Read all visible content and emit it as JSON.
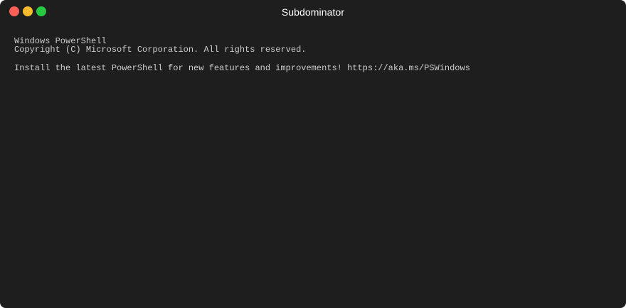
{
  "window": {
    "title": "Subdominator",
    "controls": {
      "close_color": "#ff5f57",
      "minimize_color": "#febc2e",
      "zoom_color": "#28c840"
    },
    "background": "#1e1e1e"
  },
  "terminal": {
    "lines": [
      "Windows PowerShell",
      "Copyright (C) Microsoft Corporation. All rights reserved.",
      "",
      "Install the latest PowerShell for new features and improvements! https://aka.ms/PSWindows"
    ]
  }
}
